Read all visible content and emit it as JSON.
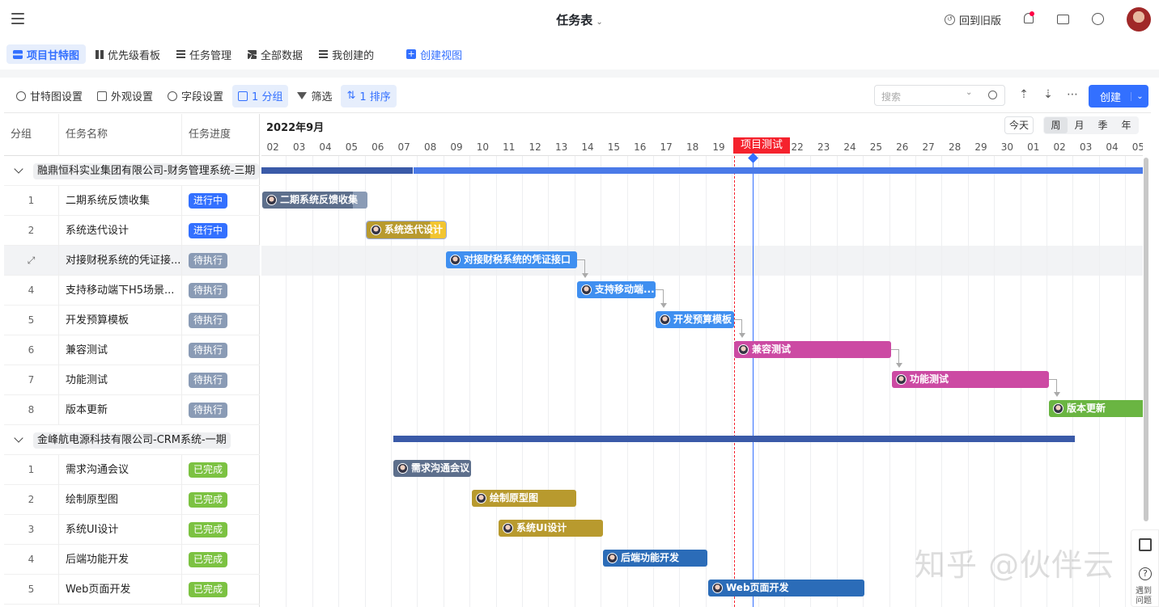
{
  "header": {
    "title": "任务表",
    "old_version": "回到旧版"
  },
  "views": [
    {
      "label": "项目甘特图",
      "active": true
    },
    {
      "label": "优先级看板"
    },
    {
      "label": "任务管理"
    },
    {
      "label": "全部数据"
    },
    {
      "label": "我创建的"
    },
    {
      "label": "创建视图"
    }
  ],
  "toolbar": {
    "gantt_settings": "甘特图设置",
    "appearance": "外观设置",
    "fields": "字段设置",
    "group": "1 分组",
    "filter": "筛选",
    "sort": "1 排序",
    "search_placeholder": "搜索",
    "create": "创建"
  },
  "columns": {
    "group": "分组",
    "name": "任务名称",
    "progress": "任务进度"
  },
  "gantt_header": {
    "month": "2022年9月",
    "today": "今天",
    "scales": [
      "周",
      "月",
      "季",
      "年"
    ],
    "active_scale": "周",
    "days": [
      "02",
      "03",
      "04",
      "05",
      "06",
      "07",
      "08",
      "09",
      "10",
      "11",
      "12",
      "13",
      "14",
      "15",
      "16",
      "17",
      "18",
      "19",
      "20",
      "21",
      "22",
      "23",
      "24",
      "25",
      "26",
      "27",
      "28",
      "29",
      "30",
      "01",
      "02",
      "03",
      "04",
      "05"
    ],
    "milestone": "项目测试"
  },
  "groups": [
    {
      "name": "融鼎恒科实业集团有限公司-财务管理系统-三期",
      "tasks": [
        {
          "num": "1",
          "name": "二期系统反馈收集",
          "status": "进行中",
          "bar_label": "二期系统反馈收集"
        },
        {
          "num": "2",
          "name": "系统迭代设计",
          "status": "进行中",
          "bar_label": "系统迭代设计"
        },
        {
          "num": "",
          "name": "对接财税系统的凭证接...",
          "status": "待执行",
          "bar_label": "对接财税系统的凭证接口"
        },
        {
          "num": "4",
          "name": "支持移动端下H5场景...",
          "status": "待执行",
          "bar_label": "支持移动端..."
        },
        {
          "num": "5",
          "name": "开发预算模板",
          "status": "待执行",
          "bar_label": "开发预算模板"
        },
        {
          "num": "6",
          "name": "兼容测试",
          "status": "待执行",
          "bar_label": "兼容测试"
        },
        {
          "num": "7",
          "name": "功能测试",
          "status": "待执行",
          "bar_label": "功能测试"
        },
        {
          "num": "8",
          "name": "版本更新",
          "status": "待执行",
          "bar_label": "版本更新"
        }
      ]
    },
    {
      "name": "金峰航电源科技有限公司-CRM系统-一期",
      "tasks": [
        {
          "num": "1",
          "name": "需求沟通会议",
          "status": "已完成",
          "bar_label": "需求沟通会议"
        },
        {
          "num": "2",
          "name": "绘制原型图",
          "status": "已完成",
          "bar_label": "绘制原型图"
        },
        {
          "num": "3",
          "name": "系统UI设计",
          "status": "已完成",
          "bar_label": "系统UI设计"
        },
        {
          "num": "4",
          "name": "后端功能开发",
          "status": "已完成",
          "bar_label": "后端功能开发"
        },
        {
          "num": "5",
          "name": "Web页面开发",
          "status": "已完成",
          "bar_label": "Web页面开发"
        }
      ]
    }
  ],
  "side": {
    "help": "遇到问题"
  },
  "watermark": "知乎 @伙伴云",
  "colors": {
    "accent": "#3370ff",
    "milestone": "#f5222d",
    "running": "#3370ff",
    "waiting": "#8a9bb5",
    "done": "#7cc242"
  }
}
